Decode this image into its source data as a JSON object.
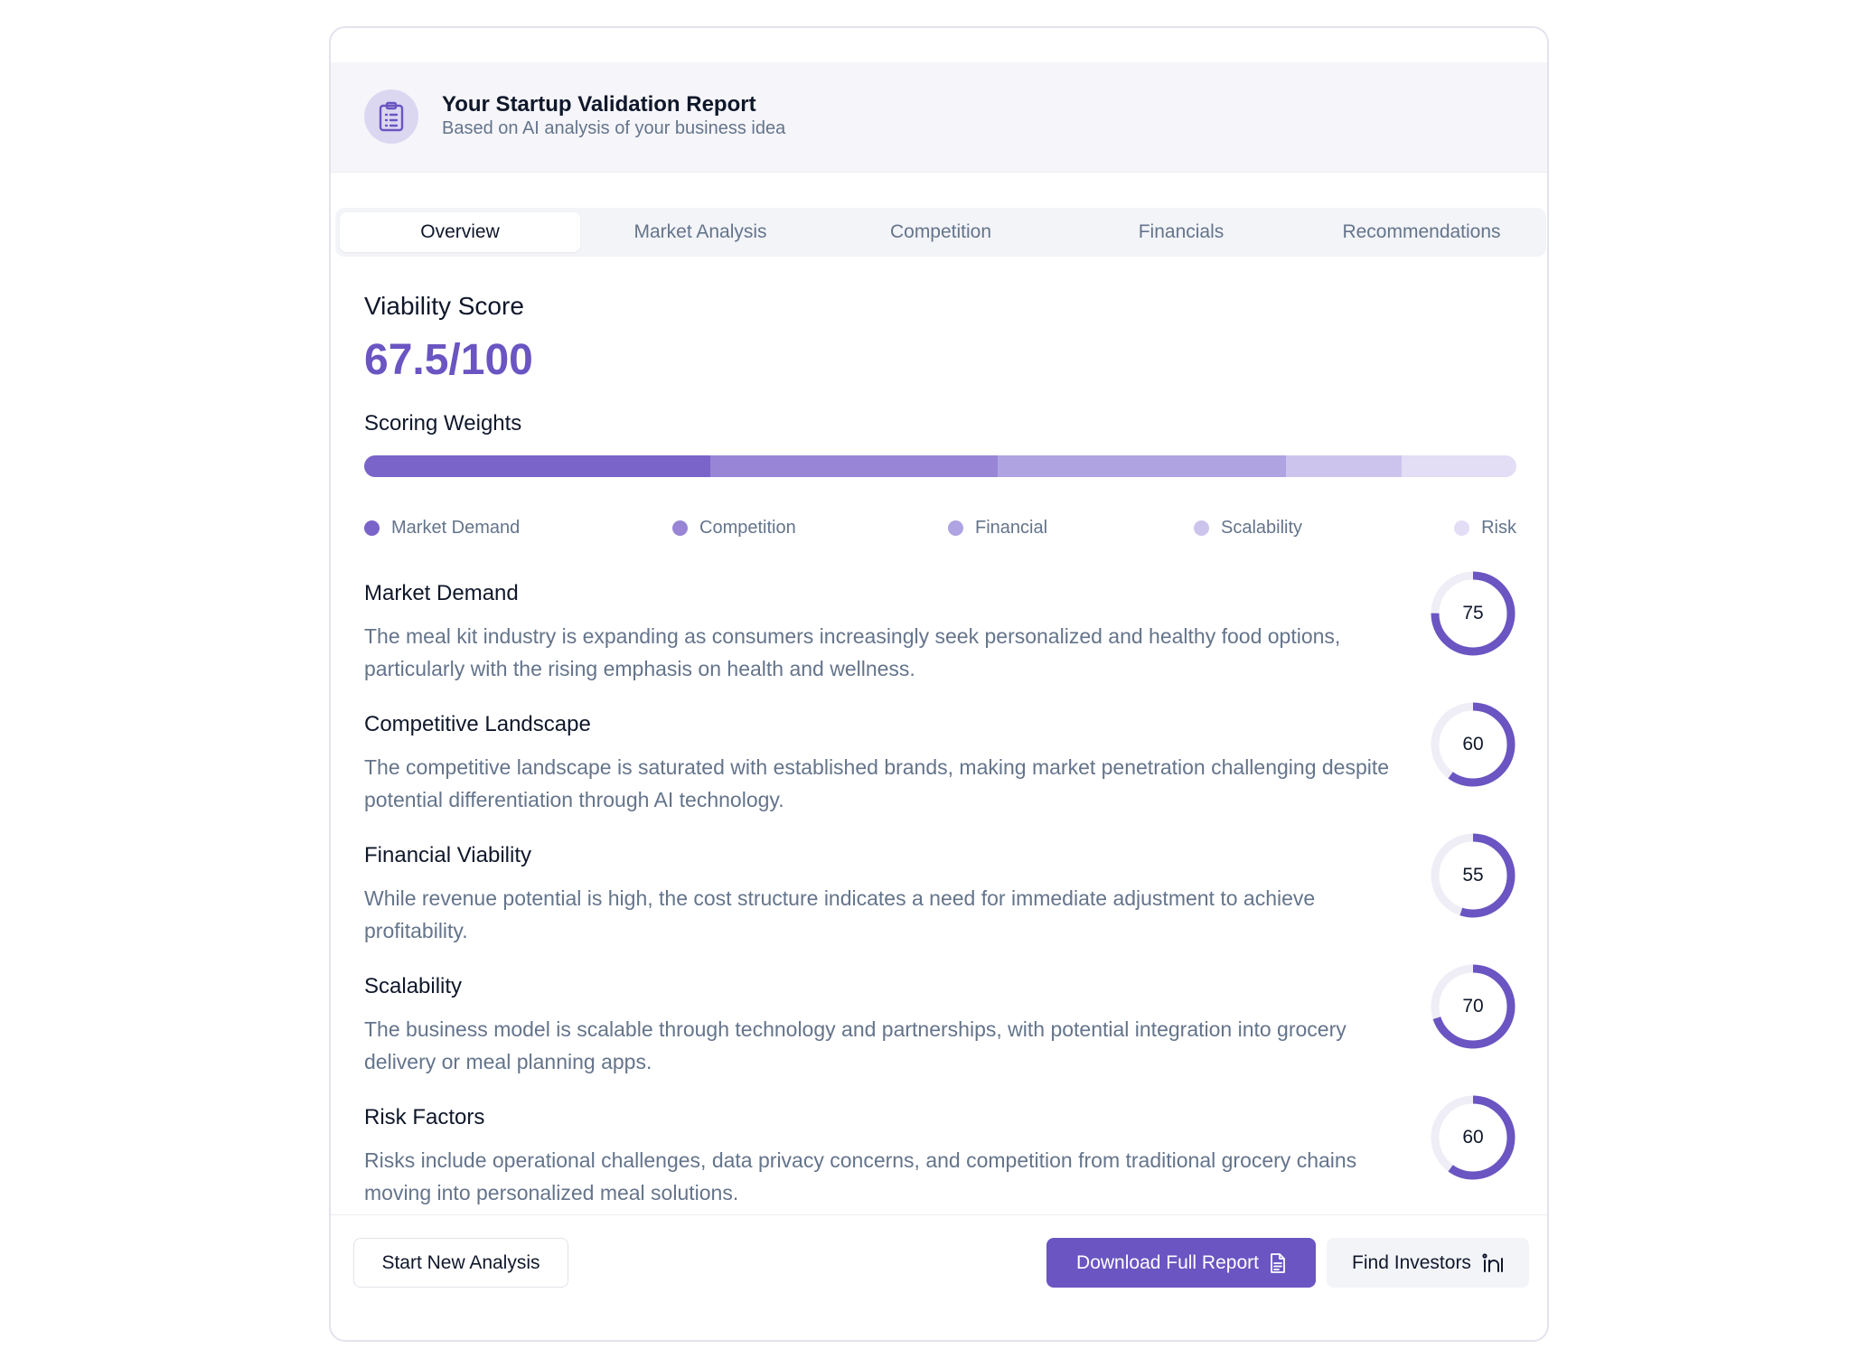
{
  "header": {
    "title": "Your Startup Validation Report",
    "subtitle": "Based on AI analysis of your business idea",
    "icon": "clipboard-icon"
  },
  "tabs": [
    {
      "label": "Overview",
      "active": true
    },
    {
      "label": "Market Analysis",
      "active": false
    },
    {
      "label": "Competition",
      "active": false
    },
    {
      "label": "Financials",
      "active": false
    },
    {
      "label": "Recommendations",
      "active": false
    }
  ],
  "viability": {
    "title": "Viability Score",
    "score": "67.5/100"
  },
  "weights": {
    "title": "Scoring Weights",
    "segments": [
      {
        "name": "Market Demand",
        "weight": 30,
        "color": "#7a64c9"
      },
      {
        "name": "Competition",
        "weight": 25,
        "color": "#9885d6"
      },
      {
        "name": "Financial",
        "weight": 25,
        "color": "#b0a3e2"
      },
      {
        "name": "Scalability",
        "weight": 10,
        "color": "#cdc4ee"
      },
      {
        "name": "Risk",
        "weight": 10,
        "color": "#e3ddf5"
      }
    ]
  },
  "criteria": [
    {
      "title": "Market Demand",
      "description": "The meal kit industry is expanding as consumers increasingly seek personalized and healthy food options, particularly with the rising emphasis on health and wellness.",
      "score": 75,
      "score_label": "75"
    },
    {
      "title": "Competitive Landscape",
      "description": "The competitive landscape is saturated with established brands, making market penetration challenging despite potential differentiation through AI technology.",
      "score": 60,
      "score_label": "60"
    },
    {
      "title": "Financial Viability",
      "description": "While revenue potential is high, the cost structure indicates a need for immediate adjustment to achieve profitability.",
      "score": 55,
      "score_label": "55"
    },
    {
      "title": "Scalability",
      "description": "The business model is scalable through technology and partnerships, with potential integration into grocery delivery or meal planning apps.",
      "score": 70,
      "score_label": "70"
    },
    {
      "title": "Risk Factors",
      "description": "Risks include operational challenges, data privacy concerns, and competition from traditional grocery chains moving into personalized meal solutions.",
      "score": 60,
      "score_label": "60"
    }
  ],
  "footer": {
    "new_label": "Start New Analysis",
    "download_label": "Download Full Report",
    "download_icon": "document-icon",
    "investors_label": "Find Investors",
    "investors_icon": "linkedin-icon"
  },
  "colors": {
    "accent": "#6a55c2",
    "donut_track": "#efedf6"
  }
}
